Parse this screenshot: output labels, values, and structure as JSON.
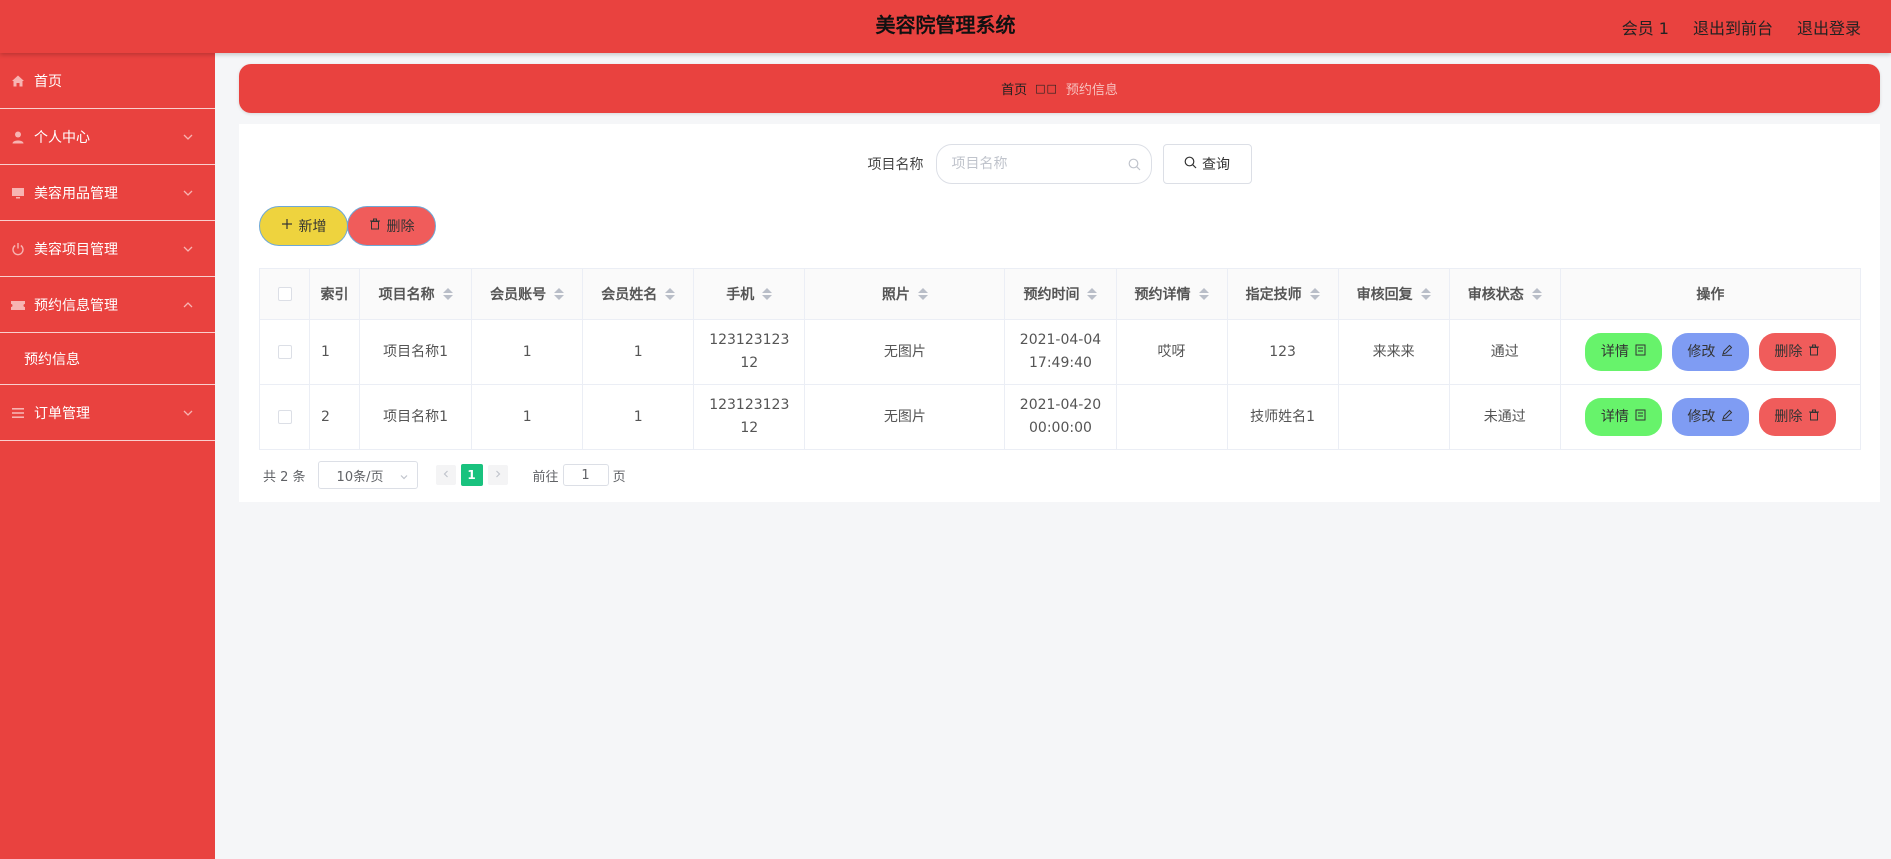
{
  "header": {
    "title": "美容院管理系统",
    "user_label": "会员 1",
    "to_front_label": "退出到前台",
    "logout_label": "退出登录"
  },
  "sidebar": {
    "items": [
      {
        "label": "首页",
        "icon": "home-icon"
      },
      {
        "label": "个人中心",
        "icon": "user-icon"
      },
      {
        "label": "美容用品管理",
        "icon": "monitor-icon"
      },
      {
        "label": "美容项目管理",
        "icon": "power-icon"
      },
      {
        "label": "预约信息管理",
        "icon": "ticket-icon"
      },
      {
        "label": "预约信息",
        "icon": ""
      },
      {
        "label": "订单管理",
        "icon": "list-icon"
      }
    ]
  },
  "breadcrumb": {
    "home": "首页",
    "separator": "□□",
    "current": "预约信息"
  },
  "search": {
    "label": "项目名称",
    "placeholder": "项目名称",
    "value": "",
    "button_label": "查询"
  },
  "actions": {
    "add_label": "新增",
    "delete_label": "删除"
  },
  "table": {
    "columns": [
      "索引",
      "项目名称",
      "会员账号",
      "会员姓名",
      "手机",
      "照片",
      "预约时间",
      "预约详情",
      "指定技师",
      "审核回复",
      "审核状态",
      "操作"
    ],
    "rows": [
      {
        "index": "1",
        "project": "项目名称1",
        "account": "1",
        "name": "1",
        "phone": "12312312312",
        "photo": "无图片",
        "time": "2021-04-04 17:49:40",
        "detail": "哎呀",
        "tech": "123",
        "reply": "来来来",
        "status": "通过"
      },
      {
        "index": "2",
        "project": "项目名称1",
        "account": "1",
        "name": "1",
        "phone": "12312312312",
        "photo": "无图片",
        "time": "2021-04-20 00:00:00",
        "detail": "",
        "tech": "技师姓名1",
        "reply": "",
        "status": "未通过"
      }
    ],
    "op_labels": {
      "detail": "详情",
      "edit": "修改",
      "delete": "删除"
    }
  },
  "pagination": {
    "total_text": "共 2 条",
    "page_size": "10条/页",
    "current_page": "1",
    "goto_label": "前往",
    "goto_value": "1",
    "page_suffix": "页"
  },
  "colors": {
    "brand_red": "#e9423f",
    "add_yellow": "#eed33e",
    "delete_red": "#f05c5b",
    "detail_green": "#67f36b",
    "edit_blue": "#7f9cf3",
    "page_active": "#19c27e"
  }
}
